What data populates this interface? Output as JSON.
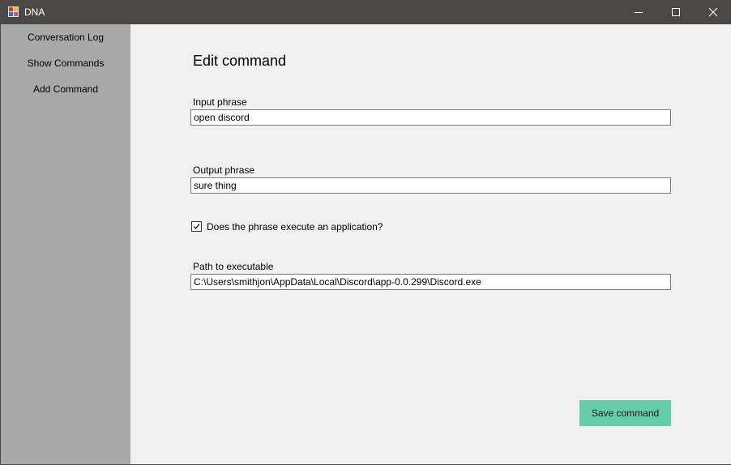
{
  "window": {
    "title": "DNA",
    "app_icon": "dna-app-icon",
    "controls": {
      "minimize_icon": "minimize-icon",
      "maximize_icon": "maximize-icon",
      "close_icon": "close-icon"
    }
  },
  "sidebar": {
    "items": [
      {
        "label": "Conversation Log"
      },
      {
        "label": "Show Commands"
      },
      {
        "label": "Add Command"
      }
    ]
  },
  "form": {
    "heading": "Edit command",
    "input_phrase": {
      "label": "Input phrase",
      "value": "open discord"
    },
    "output_phrase": {
      "label": "Output phrase",
      "value": "sure thing"
    },
    "executes_app": {
      "label": "Does the phrase execute an application?",
      "checked": true
    },
    "path": {
      "label": "Path to executable",
      "value": "C:\\Users\\smithjon\\AppData\\Local\\Discord\\app-0.0.299\\Discord.exe"
    },
    "save_label": "Save command"
  },
  "colors": {
    "titlebar": "#4a4847",
    "sidebar": "#a9a9a9",
    "content": "#f0f0f0",
    "save_button": "#66cdaa"
  }
}
